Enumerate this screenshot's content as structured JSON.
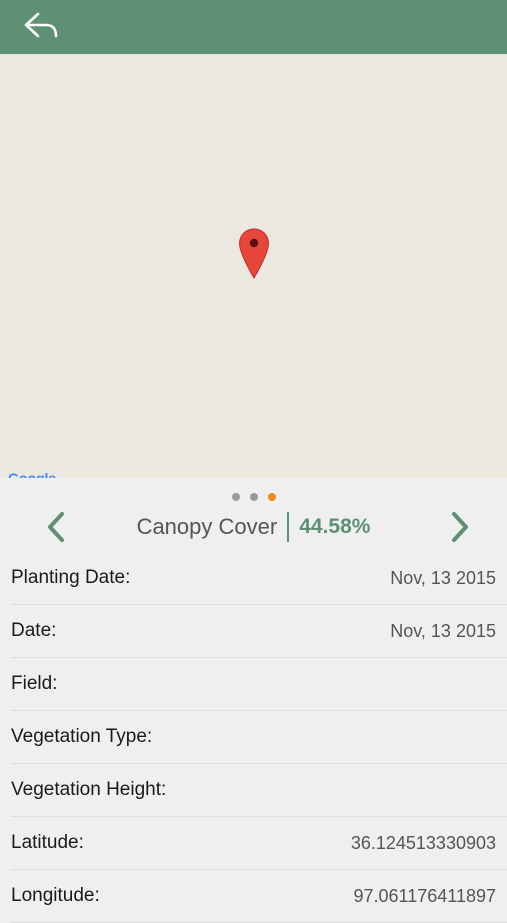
{
  "header": {
    "back_icon": "reply-arrow-icon",
    "bar_color": "#5e9173"
  },
  "map": {
    "pin_icon": "map-pin-icon",
    "pin_color": "#e8463a",
    "attribution": "Google"
  },
  "pager": {
    "page_count": 3,
    "active_index": 2,
    "active_color": "#f08c1a"
  },
  "metric": {
    "prev_icon": "chevron-left-icon",
    "next_icon": "chevron-right-icon",
    "name": "Canopy Cover",
    "value": "44.58%",
    "accent_color": "#5e9173"
  },
  "details": [
    {
      "label": "Planting Date:",
      "value": "Nov, 13 2015"
    },
    {
      "label": "Date:",
      "value": "Nov, 13 2015"
    },
    {
      "label": "Field:",
      "value": ""
    },
    {
      "label": "Vegetation Type:",
      "value": ""
    },
    {
      "label": "Vegetation Height:",
      "value": ""
    },
    {
      "label": "Latitude:",
      "value": "36.124513330903"
    },
    {
      "label": "Longitude:",
      "value": "97.061176411897"
    }
  ]
}
